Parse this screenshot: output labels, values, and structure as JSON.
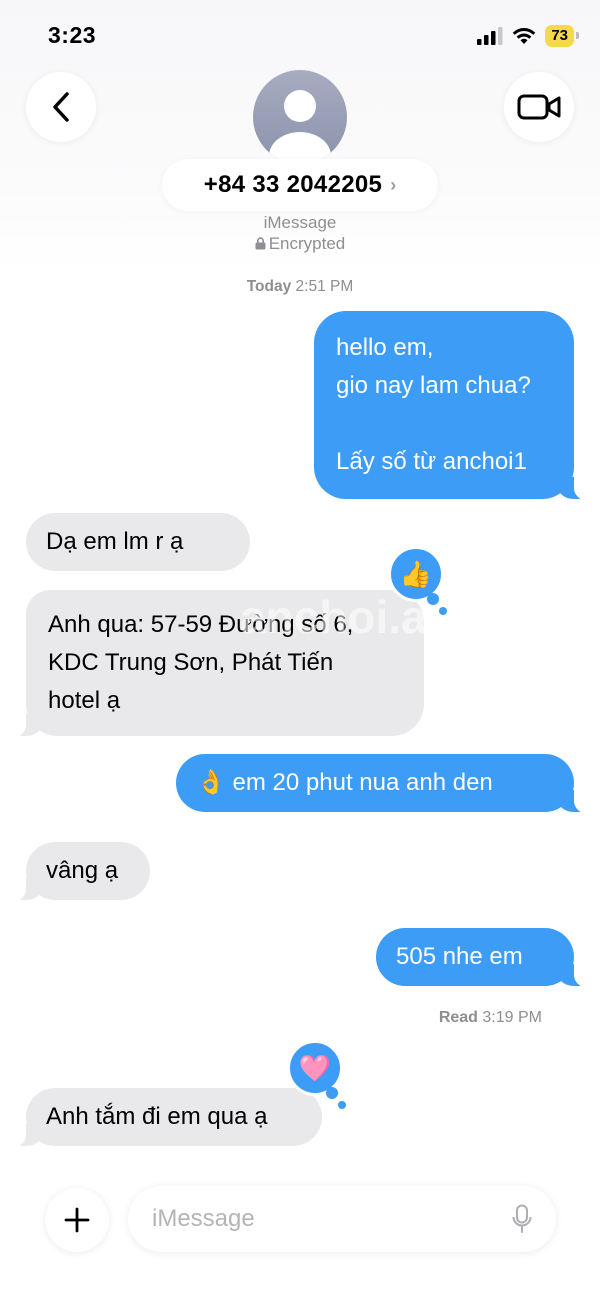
{
  "status_bar": {
    "time": "3:23",
    "battery": "73",
    "icons": [
      "cellular-signal-icon",
      "wifi-icon",
      "battery-icon"
    ]
  },
  "header": {
    "back_icon": "chevron-left-icon",
    "video_icon": "video-camera-icon",
    "avatar_icon": "person-silhouette-icon",
    "contact": "+84 33 2042205",
    "contact_chevron": "›",
    "service": "iMessage",
    "encrypted": "Encrypted"
  },
  "conversation": {
    "timestamp_day": "Today",
    "timestamp_time": "2:51 PM",
    "messages": [
      {
        "direction": "outgoing",
        "lines": [
          "hello em,",
          "gio nay lam chua?",
          "",
          "Lấy số từ anchoi1"
        ]
      },
      {
        "direction": "incoming",
        "lines": [
          "Dạ em lm r ạ"
        ]
      },
      {
        "direction": "incoming",
        "lines": [
          "Anh qua: 57-59 Đường số 6,",
          "KDC Trung Sơn, Phát Tiến",
          "hotel ạ"
        ]
      },
      {
        "direction": "outgoing",
        "lines": [
          "👌 em 20 phut nua anh den"
        ]
      },
      {
        "direction": "incoming",
        "lines": [
          "vâng ạ"
        ]
      },
      {
        "direction": "outgoing",
        "lines": [
          "505 nhe em"
        ]
      },
      {
        "direction": "incoming",
        "lines": [
          "Anh tắm đi em qua ạ"
        ]
      }
    ],
    "reactions": [
      {
        "emoji": "👍",
        "icon": "thumbs-up-icon"
      },
      {
        "emoji": "🩷",
        "icon": "heart-icon"
      }
    ],
    "read_label": "Read",
    "read_time": "3:19 PM",
    "watermark": "anchoi.ac"
  },
  "composer": {
    "placeholder": "iMessage",
    "plus_icon": "plus-icon",
    "mic_icon": "microphone-icon"
  },
  "colors": {
    "outgoing_bubble": "#3d9cf6",
    "incoming_bubble": "#e9e9eb",
    "secondary_text": "#8e8e93",
    "battery_fill": "#f5d94a"
  }
}
